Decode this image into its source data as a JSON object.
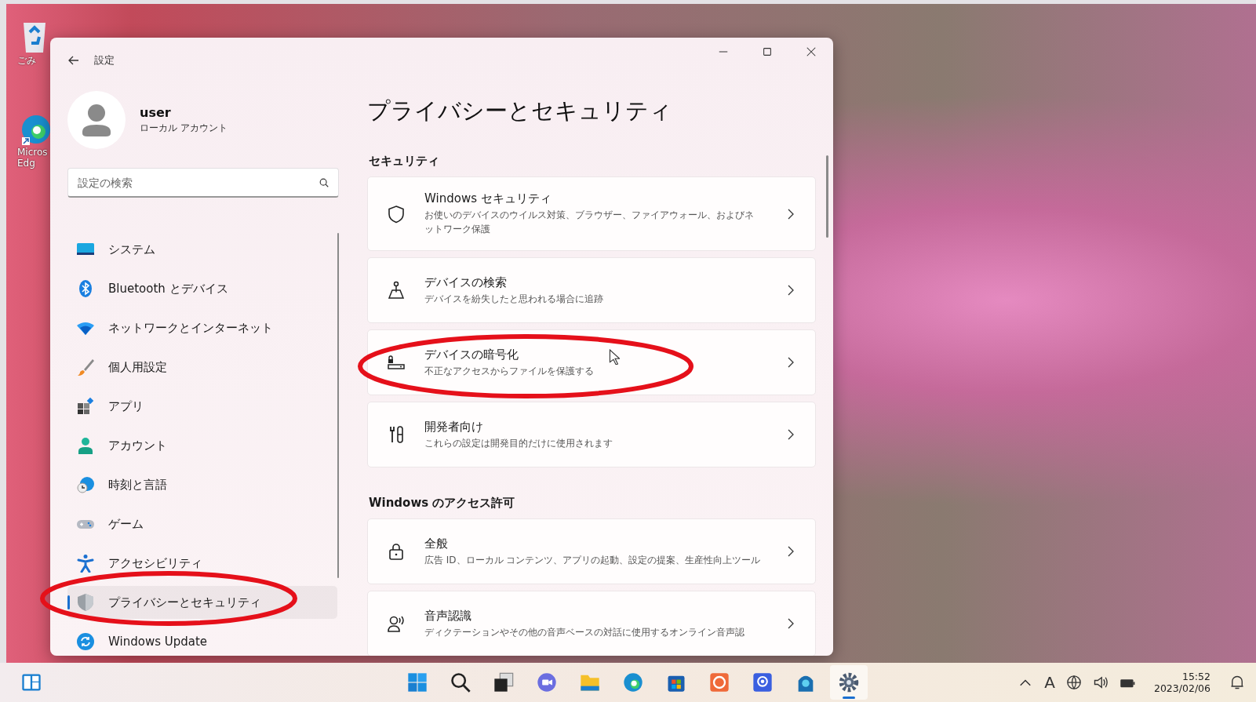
{
  "desktop": {
    "icons": [
      {
        "kind": "recycle-bin",
        "lines": [
          "ごみ"
        ]
      },
      {
        "kind": "browser",
        "lines": [
          "Micros",
          "Edg"
        ]
      }
    ]
  },
  "window": {
    "title": "設定",
    "account": {
      "name": "user",
      "type": "ローカル アカウント"
    },
    "search": {
      "placeholder": "設定の検索"
    },
    "nav": [
      {
        "kind": "system",
        "label": "システム",
        "selected": false
      },
      {
        "kind": "bluetooth",
        "label": "Bluetooth とデバイス",
        "selected": false
      },
      {
        "kind": "network",
        "label": "ネットワークとインターネット",
        "selected": false
      },
      {
        "kind": "personalization",
        "label": "個人用設定",
        "selected": false
      },
      {
        "kind": "apps",
        "label": "アプリ",
        "selected": false
      },
      {
        "kind": "accounts",
        "label": "アカウント",
        "selected": false
      },
      {
        "kind": "time",
        "label": "時刻と言語",
        "selected": false
      },
      {
        "kind": "gaming",
        "label": "ゲーム",
        "selected": false
      },
      {
        "kind": "accessibility",
        "label": "アクセシビリティ",
        "selected": false
      },
      {
        "kind": "privacy",
        "label": "プライバシーとセキュリティ",
        "selected": true
      },
      {
        "kind": "update",
        "label": "Windows Update",
        "selected": false
      }
    ],
    "page_title": "プライバシーとセキュリティ",
    "sections": [
      {
        "heading": "セキュリティ",
        "items": [
          {
            "kind": "shield",
            "title": "Windows セキュリティ",
            "description": "お使いのデバイスのウイルス対策、ブラウザー、ファイアウォール、およびネットワーク保護"
          },
          {
            "kind": "find-device",
            "title": "デバイスの検索",
            "description": "デバイスを紛失したと思われる場合に追跡"
          },
          {
            "kind": "encryption",
            "title": "デバイスの暗号化",
            "description": "不正なアクセスからファイルを保護する"
          },
          {
            "kind": "developer",
            "title": "開発者向け",
            "description": "これらの設定は開発目的だけに使用されます"
          }
        ]
      },
      {
        "heading": "Windows のアクセス許可",
        "items": [
          {
            "kind": "lock",
            "title": "全般",
            "description": "広告 ID、ローカル コンテンツ、アプリの起動、設定の提案、生産性向上ツール"
          },
          {
            "kind": "speech",
            "title": "音声認識",
            "description": "ディクテーションやその他の音声ベースの対話に使用するオンライン音声認"
          }
        ]
      }
    ]
  },
  "taskbar": {
    "apps": [
      {
        "kind": "start",
        "active": false
      },
      {
        "kind": "search",
        "active": false
      },
      {
        "kind": "task-view",
        "active": false
      },
      {
        "kind": "chat",
        "active": false
      },
      {
        "kind": "explorer",
        "active": false
      },
      {
        "kind": "edge",
        "active": false
      },
      {
        "kind": "store",
        "active": false
      },
      {
        "kind": "orange-app",
        "active": false
      },
      {
        "kind": "mail",
        "active": false
      },
      {
        "kind": "blue-app",
        "active": false
      },
      {
        "kind": "settings",
        "active": true
      }
    ],
    "ime": "A",
    "time": "15:52",
    "date": "2023/02/06"
  }
}
